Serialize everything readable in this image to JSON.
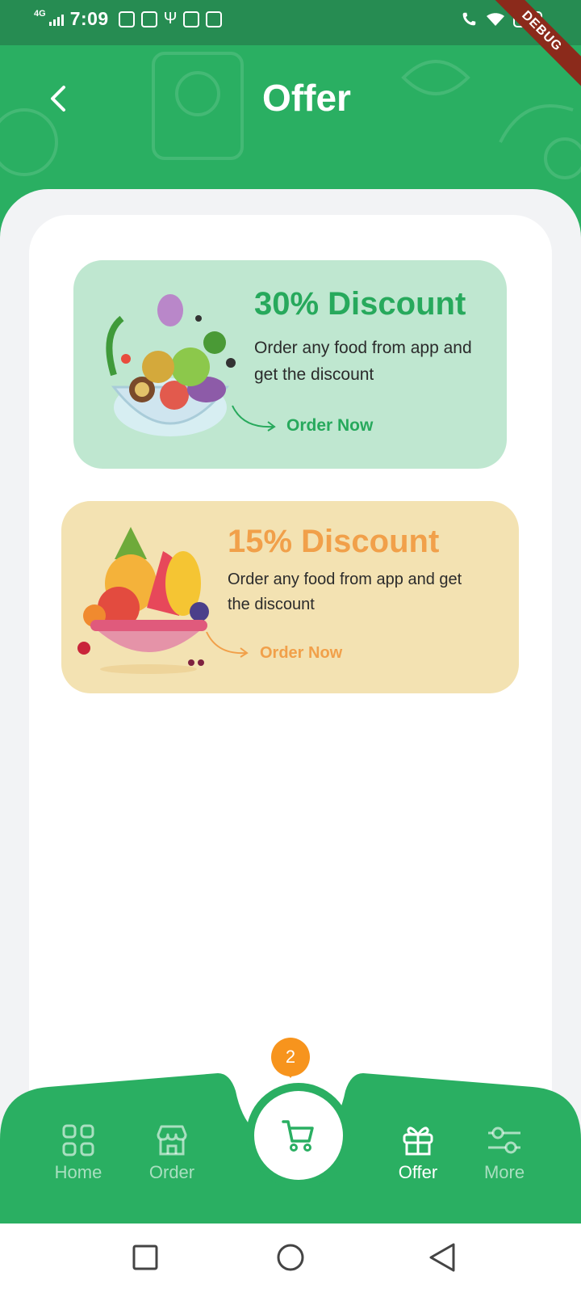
{
  "status_bar": {
    "network": "4G",
    "time": "7:09",
    "battery": "100",
    "debug_banner": "DEBUG"
  },
  "header": {
    "title": "Offer",
    "back_icon": "chevron-left-icon"
  },
  "offers": [
    {
      "title": "30% Discount",
      "description": "Order any food from app and get the discount",
      "cta": "Order Now",
      "title_color": "#27a95c",
      "card_color": "#bfe7d0"
    },
    {
      "title": "15% Discount",
      "description": "Order any food from app and get the discount",
      "cta": "Order Now",
      "title_color": "#f1a04a",
      "card_color": "#f3e2b2"
    }
  ],
  "bottom_nav": {
    "items": [
      {
        "label": "Home",
        "icon": "grid-icon",
        "active": false
      },
      {
        "label": "Order",
        "icon": "store-icon",
        "active": false
      },
      {
        "label": "Offer",
        "icon": "gift-icon",
        "active": true
      },
      {
        "label": "More",
        "icon": "sliders-icon",
        "active": false
      }
    ],
    "cart": {
      "icon": "cart-icon",
      "badge_count": "2"
    }
  },
  "colors": {
    "brand_green": "#2aaf62",
    "badge_orange": "#f7941d"
  }
}
